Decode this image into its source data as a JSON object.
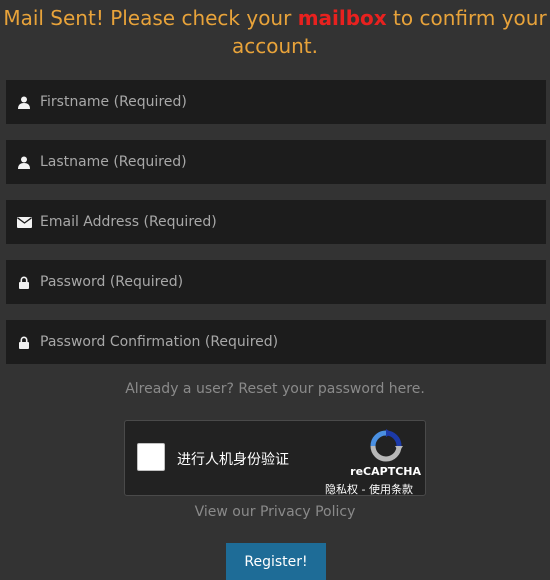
{
  "notice": {
    "before": "Mail Sent! Please check your ",
    "highlight": "mailbox",
    "after": " to confirm your account."
  },
  "fields": [
    {
      "icon": "user-icon",
      "placeholder": "Firstname (Required)",
      "value": ""
    },
    {
      "icon": "user-icon",
      "placeholder": "Lastname (Required)",
      "value": ""
    },
    {
      "icon": "envelope-icon",
      "placeholder": "Email Address (Required)",
      "value": ""
    },
    {
      "icon": "lock-icon",
      "placeholder": "Password (Required)",
      "value": ""
    },
    {
      "icon": "lock-icon",
      "placeholder": "Password Confirmation (Required)",
      "value": ""
    }
  ],
  "reset_link": "Already a user? Reset your password here.",
  "captcha": {
    "label": "进行人机身份验证",
    "brand": "reCAPTCHA",
    "terms": "隐私权 - 使用条款"
  },
  "privacy_link": "View our Privacy Policy",
  "register_label": "Register!",
  "colors": {
    "background": "#333333",
    "notice": "#e8a33a",
    "highlight": "#e8211f",
    "field_bg": "#1c1c1c",
    "button": "#1e6c97"
  }
}
